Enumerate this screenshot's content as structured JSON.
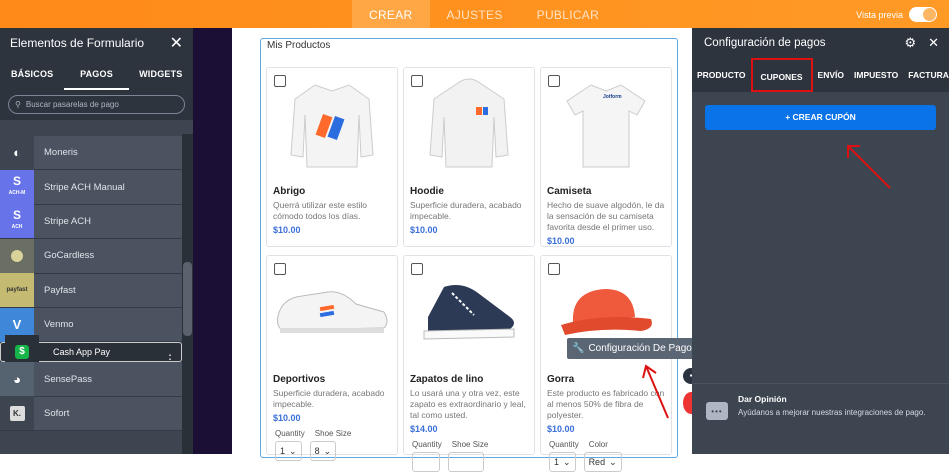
{
  "top": {
    "tabs": [
      "CREAR",
      "AJUSTES",
      "PUBLICAR"
    ],
    "preview": "Vista previa"
  },
  "left": {
    "title": "Elementos de Formulario",
    "tabs": [
      "BÁSICOS",
      "PAGOS",
      "WIDGETS"
    ],
    "search_placeholder": "Buscar pasarelas de pago",
    "items": [
      {
        "label": "Moneris",
        "icon": "moneris-icon",
        "color": "#3d4551"
      },
      {
        "label": "Stripe ACH Manual",
        "icon": "stripe-ach-manual-icon",
        "color": "#6773e8"
      },
      {
        "label": "Stripe ACH",
        "icon": "stripe-ach-icon",
        "color": "#6773e8"
      },
      {
        "label": "GoCardless",
        "icon": "gocardless-icon",
        "color": "#6b6e62"
      },
      {
        "label": "Payfast",
        "icon": "payfast-icon",
        "color": "#c4ba72"
      },
      {
        "label": "Venmo",
        "icon": "venmo-icon",
        "color": "#3f88d9"
      },
      {
        "label": "Cash App Pay",
        "icon": "cash-app-icon",
        "color": "#15b54a"
      },
      {
        "label": "SensePass",
        "icon": "sensepass-icon",
        "color": "#556270"
      },
      {
        "label": "Sofort",
        "icon": "sofort-icon",
        "color": "#3d4551"
      }
    ],
    "icon_text": {
      "stripe_ach_manual": "S",
      "stripe_ach_manual_sub": "ACH-M",
      "stripe_ach": "S",
      "stripe_ach_sub": "ACH",
      "payfast": "payfast",
      "venmo": "V",
      "cash": "$",
      "sofort": "K."
    }
  },
  "canvas": {
    "section_title": "Mis Productos",
    "products": [
      {
        "name": "Abrigo",
        "desc": "Querrá utilizar este estilo cómodo todos los días.",
        "price": "$10.00"
      },
      {
        "name": "Hoodie",
        "desc": "Superficie duradera, acabado impecable.",
        "price": "$10.00"
      },
      {
        "name": "Camiseta",
        "desc": "Hecho de suave algodón, le da la sensación de su camiseta favorita desde el primer uso.",
        "price": "$10.00",
        "logo": "Jotform"
      },
      {
        "name": "Deportivos",
        "desc": "Superficie duradera, acabado impecable.",
        "price": "$10.00",
        "opt1": "Quantity",
        "opt2": "Shoe Size",
        "v1": "1",
        "v2": "8"
      },
      {
        "name": "Zapatos de lino",
        "desc": "Lo usará una y otra vez, este zapato es extraordinario y leal, tal como usted.",
        "price": "$14.00",
        "opt1": "Quantity",
        "opt2": "Shoe Size"
      },
      {
        "name": "Gorra",
        "desc": "Este producto es fabricado con al menos 50% de fibra de polyester.",
        "price": "$10.00",
        "opt1": "Quantity",
        "opt2": "Color",
        "v1": "1",
        "v2": "Red"
      }
    ],
    "tooltip": "Configuración De Pagos"
  },
  "right": {
    "title": "Configuración de pagos",
    "tabs": [
      "PRODUCTO",
      "CUPONES",
      "ENVÍO",
      "IMPUESTO",
      "FACTURA"
    ],
    "active_tab": "CUPONES",
    "button": "CREAR CUPÓN",
    "feedback_title": "Dar Opinión",
    "feedback_text": "Ayúdanos a mejorar nuestras integraciones de pago."
  }
}
